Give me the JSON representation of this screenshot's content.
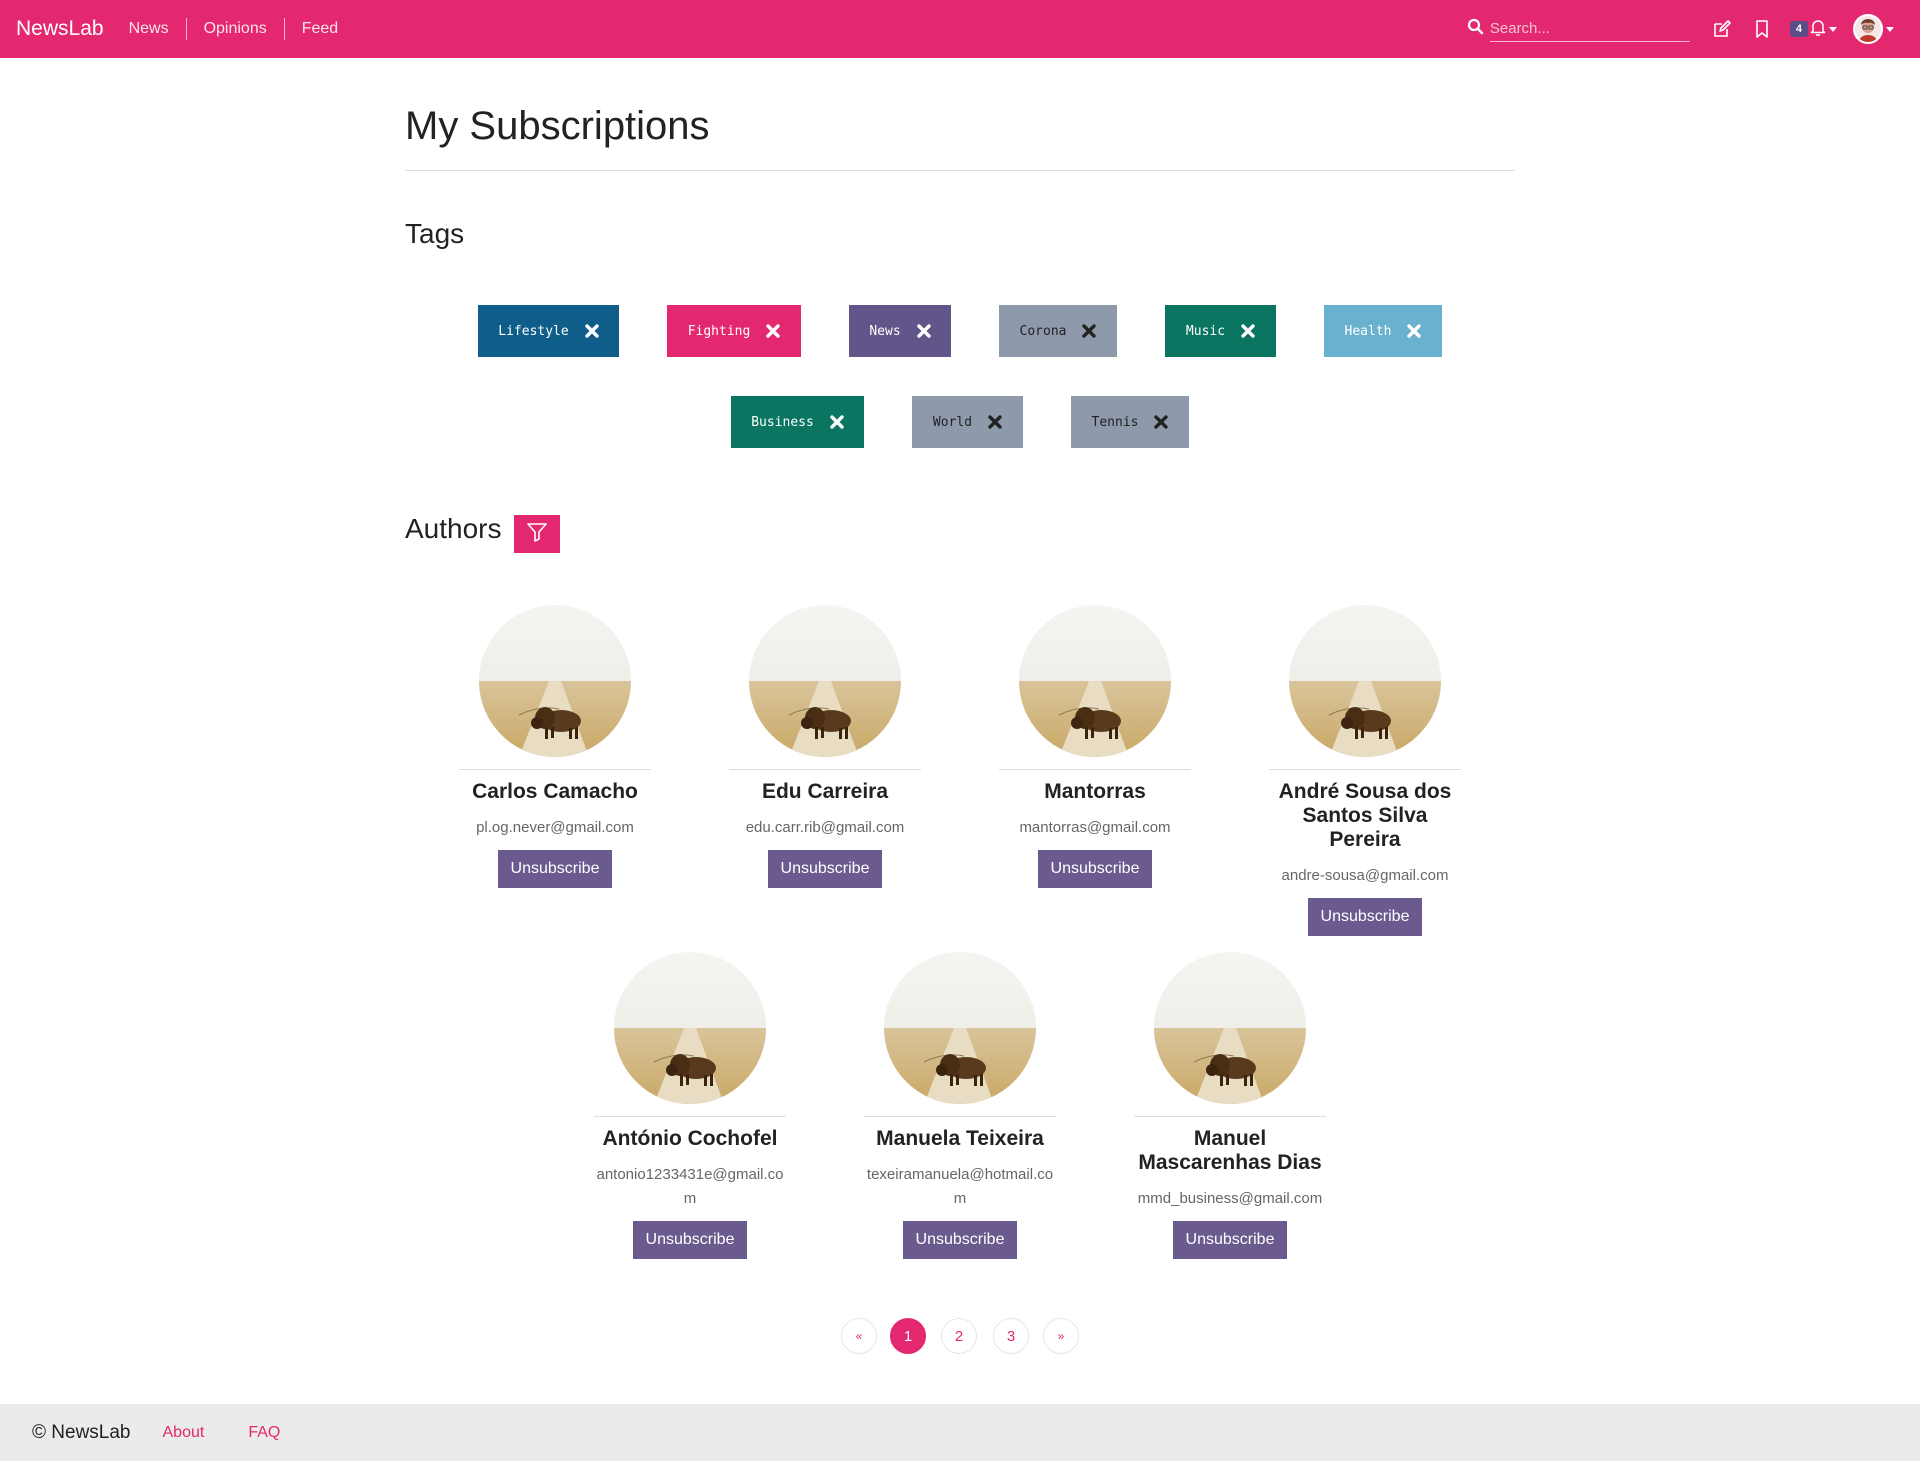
{
  "navbar": {
    "brand": "NewsLab",
    "links": [
      "News",
      "Opinions",
      "Feed"
    ],
    "search_placeholder": "Search...",
    "notification_count": "4"
  },
  "page": {
    "title": "My Subscriptions"
  },
  "tags_section": {
    "title": "Tags",
    "tags": [
      {
        "label": "Lifestyle",
        "bg": "#0f5e8a",
        "fg": "#ffffff"
      },
      {
        "label": "Fighting",
        "bg": "#e3286f",
        "fg": "#ffffff"
      },
      {
        "label": "News",
        "bg": "#62558a",
        "fg": "#ffffff"
      },
      {
        "label": "Corona",
        "bg": "#8e9aac",
        "fg": "#222222"
      },
      {
        "label": "Music",
        "bg": "#0a7662",
        "fg": "#ffffff"
      },
      {
        "label": "Health",
        "bg": "#6ab1d0",
        "fg": "#ffffff"
      },
      {
        "label": "Business",
        "bg": "#0a7662",
        "fg": "#ffffff"
      },
      {
        "label": "World",
        "bg": "#8e9aac",
        "fg": "#222222"
      },
      {
        "label": "Tennis",
        "bg": "#8e9aac",
        "fg": "#222222"
      }
    ]
  },
  "authors_section": {
    "title": "Authors",
    "unsubscribe_label": "Unsubscribe",
    "authors": [
      {
        "name": "Carlos Camacho",
        "email": "pl.og.never@gmail.com"
      },
      {
        "name": "Edu Carreira",
        "email": "edu.carr.rib@gmail.com"
      },
      {
        "name": "Mantorras",
        "email": "mantorras@gmail.com"
      },
      {
        "name": "André Sousa dos Santos Silva Pereira",
        "email": "andre-sousa@gmail.com"
      },
      {
        "name": "António Cochofel",
        "email": "antonio1233431e@gmail.com"
      },
      {
        "name": "Manuela Teixeira",
        "email": "texeiramanuela@hotmail.com"
      },
      {
        "name": "Manuel Mascarenhas Dias",
        "email": "mmd_business@gmail.com"
      }
    ]
  },
  "pagination": {
    "prev": "«",
    "pages": [
      "1",
      "2",
      "3"
    ],
    "active_page": "1",
    "next": "»"
  },
  "footer": {
    "brand": "© NewsLab",
    "links": [
      "About",
      "FAQ"
    ]
  },
  "colors": {
    "accent": "#e3286f",
    "button_purple": "#6b5a8e"
  }
}
